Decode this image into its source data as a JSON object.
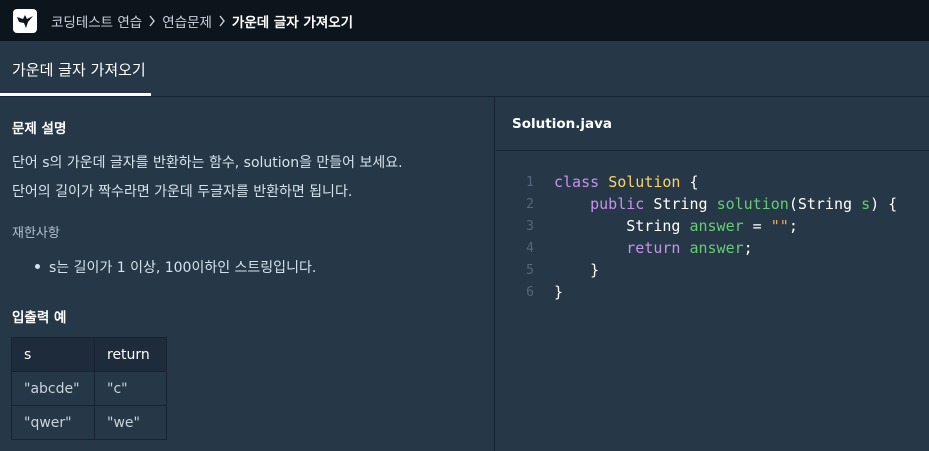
{
  "breadcrumb": {
    "items": [
      "코딩테스트 연습",
      "연습문제"
    ],
    "current": "가운데 글자 가져오기"
  },
  "tab": {
    "label": "가운데 글자 가져오기"
  },
  "problem": {
    "heading": "문제 설명",
    "description_lines": [
      "단어 s의 가운데 글자를 반환하는 함수, solution을 만들어 보세요.",
      "단어의 길이가 짝수라면 가운데 두글자를 반환하면 됩니다."
    ],
    "constraints_label": "재한사항",
    "constraints": [
      "s는 길이가 1 이상, 100이하인 스트링입니다."
    ],
    "io_heading": "입출력 예",
    "io_table": {
      "headers": [
        "s",
        "return"
      ],
      "rows": [
        [
          "\"abcde\"",
          "\"c\""
        ],
        [
          "\"qwer\"",
          "\"we\""
        ]
      ]
    }
  },
  "editor": {
    "file_name": "Solution.java",
    "line_numbers": [
      "1",
      "2",
      "3",
      "4",
      "5",
      "6"
    ],
    "tokens": {
      "l1_kw": "class",
      "l1_cls": "Solution",
      "l1_brace": " {",
      "l2_kw": "public",
      "l2_type": " String ",
      "l2_fn": "solution",
      "l2_open": "(String ",
      "l2_param": "s",
      "l2_close": ") {",
      "l3_type": "String ",
      "l3_var": "answer",
      "l3_eq": " = ",
      "l3_str": "\"\"",
      "l3_semi": ";",
      "l4_kw": "return",
      "l4_sp": " ",
      "l4_var": "answer",
      "l4_semi": ";",
      "l5": "}",
      "l6": "}"
    }
  },
  "colors": {
    "background": "#263747",
    "topbar": "#0c151c",
    "keyword": "#c792ea",
    "class_name": "#ffd55f",
    "identifier": "#67cc73",
    "string": "#f2a857"
  }
}
